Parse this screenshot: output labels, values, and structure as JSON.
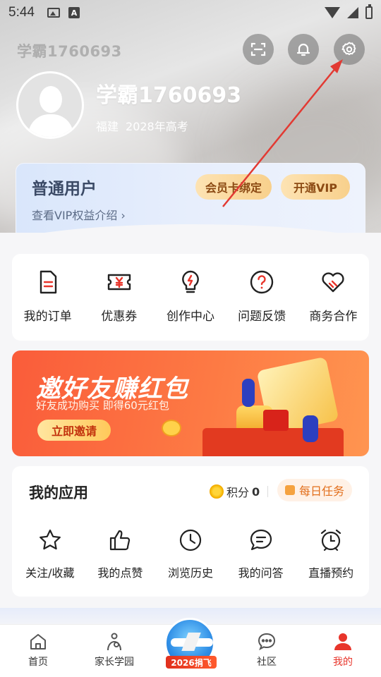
{
  "status_bar": {
    "time": "5:44"
  },
  "header": {
    "ghost_title": "学霸1760693",
    "username": "学霸1760693",
    "region": "福建",
    "exam_year": "2028年高考"
  },
  "member": {
    "level": "普通用户",
    "link": "查看VIP权益介绍 ›",
    "bind_btn": "会员卡绑定",
    "vip_btn": "开通VIP"
  },
  "quick": [
    {
      "label": "我的订单",
      "icon": "order-icon"
    },
    {
      "label": "优惠券",
      "icon": "coupon-icon"
    },
    {
      "label": "创作中心",
      "icon": "bulb-icon"
    },
    {
      "label": "问题反馈",
      "icon": "question-icon"
    },
    {
      "label": "商务合作",
      "icon": "handshake-heart-icon"
    }
  ],
  "banner": {
    "title": "邀好友赚红包",
    "subtitle": "好友成功购买 即得60元红包",
    "button": "立即邀请"
  },
  "apps": {
    "title": "我的应用",
    "points_label": "积分",
    "points_value": "0",
    "daily": "每日任务",
    "items": [
      {
        "label": "关注/收藏",
        "icon": "star-icon"
      },
      {
        "label": "我的点赞",
        "icon": "thumb-up-icon"
      },
      {
        "label": "浏览历史",
        "icon": "clock-icon"
      },
      {
        "label": "我的问答",
        "icon": "chat-icon"
      },
      {
        "label": "直播预约",
        "icon": "alarm-icon"
      }
    ]
  },
  "tabbar": {
    "items": [
      {
        "label": "首页",
        "icon": "home-icon"
      },
      {
        "label": "家长学园",
        "icon": "parent-icon"
      },
      {
        "label": "2026捐飞",
        "icon": "plane-badge"
      },
      {
        "label": "社区",
        "icon": "community-icon"
      },
      {
        "label": "我的",
        "icon": "profile-icon"
      }
    ]
  },
  "colors": {
    "accent": "#e8352b",
    "banner": "#fa5c3a",
    "vip_btn": "#f8d08c"
  }
}
